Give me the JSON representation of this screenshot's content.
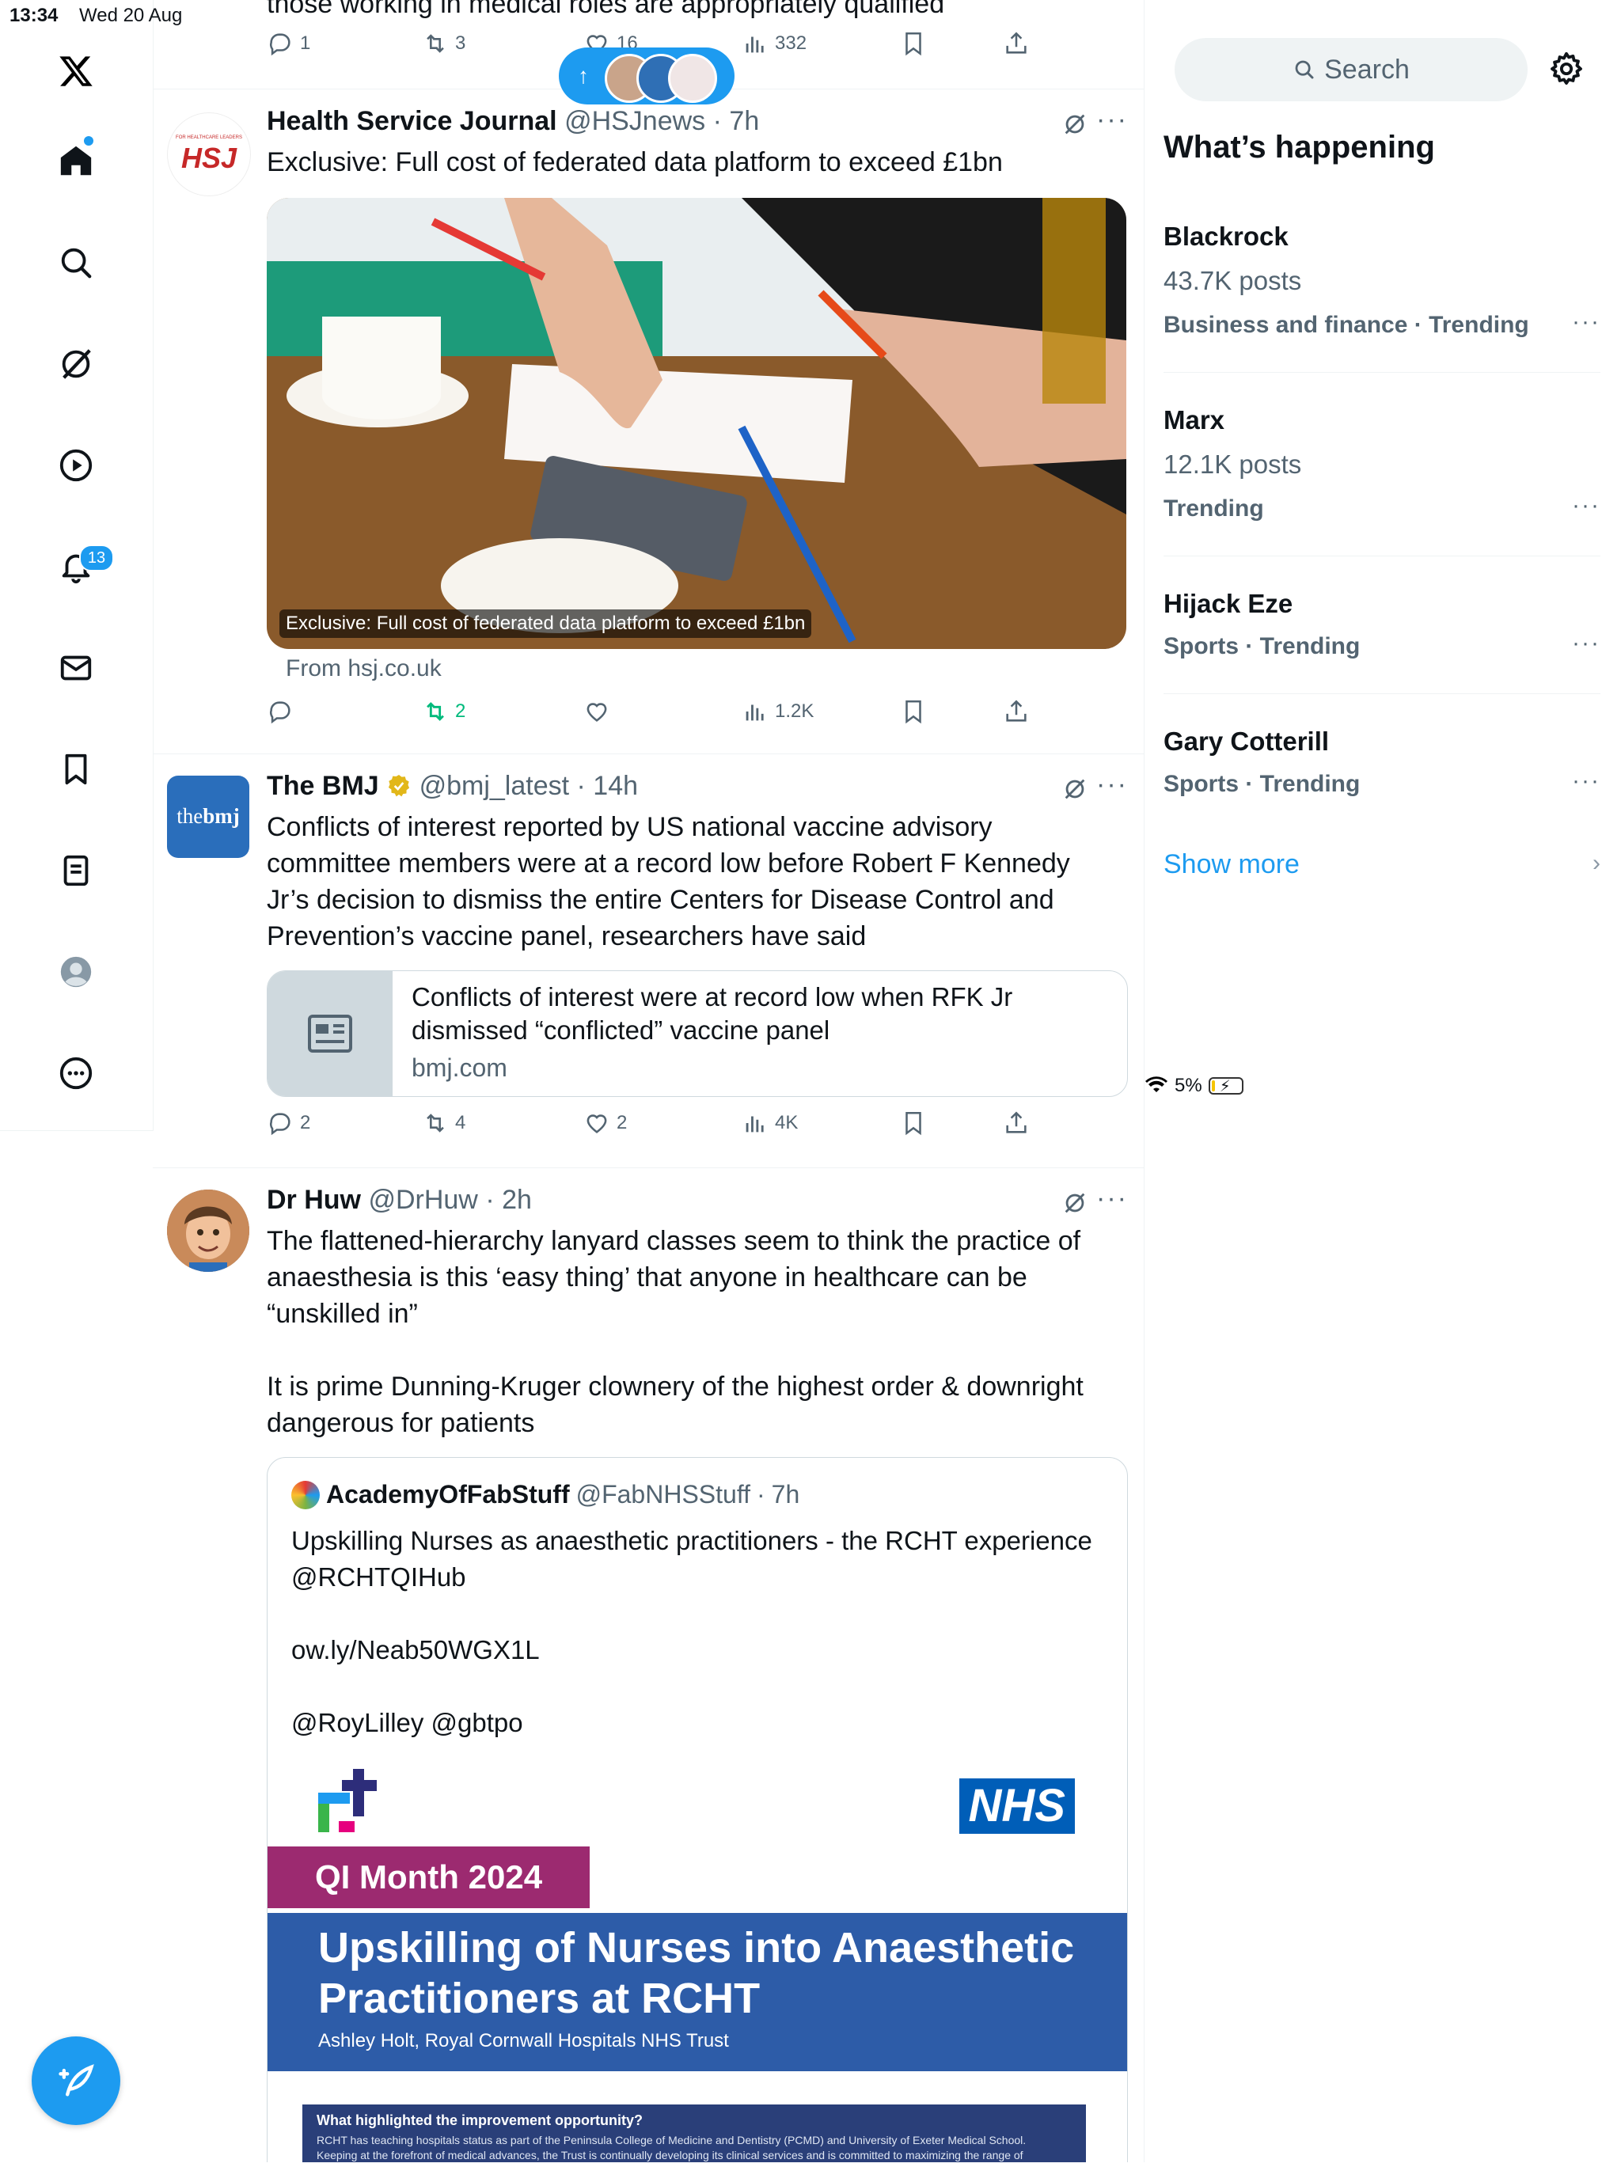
{
  "status_bar": {
    "time": "13:34",
    "date": "Wed 20 Aug",
    "battery": "5%"
  },
  "nav": {
    "items": [
      "home",
      "explore",
      "grok",
      "videos",
      "notifications",
      "messages",
      "bookmarks",
      "lists",
      "profile",
      "more"
    ],
    "notifications_count": "13"
  },
  "pill": {
    "arrow": "↑"
  },
  "top_partial": {
    "text": "those   working in medical roles   are appropriately qualified",
    "replies": "1",
    "reposts": "3",
    "likes": "16",
    "views": "332"
  },
  "tweets": [
    {
      "name": "Health Service Journal",
      "handle": "@HSJnews",
      "time": "7h",
      "avatar_text": "HSJ",
      "avatar_small": "FOR HEALTHCARE LEADERS",
      "text": "Exclusive: Full cost of federated data platform to exceed £1bn",
      "media_caption": "Exclusive: Full cost of federated data platform to exceed £1bn",
      "from": "From hsj.co.uk",
      "replies": "",
      "reposts": "2",
      "likes": "",
      "views": "1.2K"
    },
    {
      "name": "The BMJ",
      "handle": "@bmj_latest",
      "time": "14h",
      "avatar_text_a": "the",
      "avatar_text_b": "bmj",
      "text": "Conflicts of interest reported by US national vaccine advisory committee members were at a record low before Robert F Kennedy Jr’s decision to dismiss the entire Centers for Disease Control and Prevention’s vaccine panel, researchers have said",
      "card_title": "Conflicts of interest were at record low when RFK Jr dismissed “conflicted” vaccine panel",
      "card_domain": "bmj.com",
      "replies": "2",
      "reposts": "4",
      "likes": "2",
      "views": "4K"
    },
    {
      "name": "Dr Huw",
      "handle": "@DrHuw",
      "time": "2h",
      "text_p1": "The flattened-hierarchy lanyard classes seem to think the practice of anaesthesia is this ‘easy thing’ that anyone in healthcare can be “unskilled in”",
      "text_p2": "It is prime Dunning-Kruger clownery of the highest order & downright dangerous for patients",
      "quote": {
        "name": "AcademyOfFabStuff",
        "handle": "@FabNHSStuff",
        "time": "7h",
        "line1": "Upskilling Nurses as anaesthetic practitioners - the RCHT experience @RCHTQIHub",
        "line2": "ow.ly/Neab50WGX1L",
        "line3": "@RoyLilley @gbtpo",
        "image": {
          "nhs": "NHS",
          "banner": "QI Month 2024",
          "title": "Upskilling of Nurses into Anaesthetic Practitioners at RCHT",
          "author": "Ashley Holt, Royal Cornwall Hospitals NHS Trust",
          "box_head": "What highlighted the improvement opportunity?",
          "box_body": "RCHT has teaching hospitals status as part of the Peninsula College of Medicine and Dentistry (PCMD) and University of Exeter Medical School. Keeping at the forefront of medical advances, the Trust is continually developing its clinical services and is committed to maximizing the range of specialist care that can be offered locally. Allied to this is a growing reputation for research and innovation."
        }
      }
    }
  ],
  "sidebar": {
    "search_placeholder": "Search",
    "heading": "What’s happening",
    "trends": [
      {
        "title": "Blackrock",
        "posts": "43.7K posts",
        "meta": "Business and finance · Trending"
      },
      {
        "title": "Marx",
        "posts": "12.1K posts",
        "meta": "Trending"
      },
      {
        "title": "Hijack Eze",
        "posts": "",
        "meta": "Sports · Trending"
      },
      {
        "title": "Gary Cotterill",
        "posts": "",
        "meta": "Sports · Trending"
      }
    ],
    "show_more": "Show more"
  },
  "colors": {
    "accent": "#1d9bf0",
    "repost_active": "#00ba7c",
    "text": "#0f1419",
    "muted": "#536471",
    "border": "#eff3f4"
  }
}
